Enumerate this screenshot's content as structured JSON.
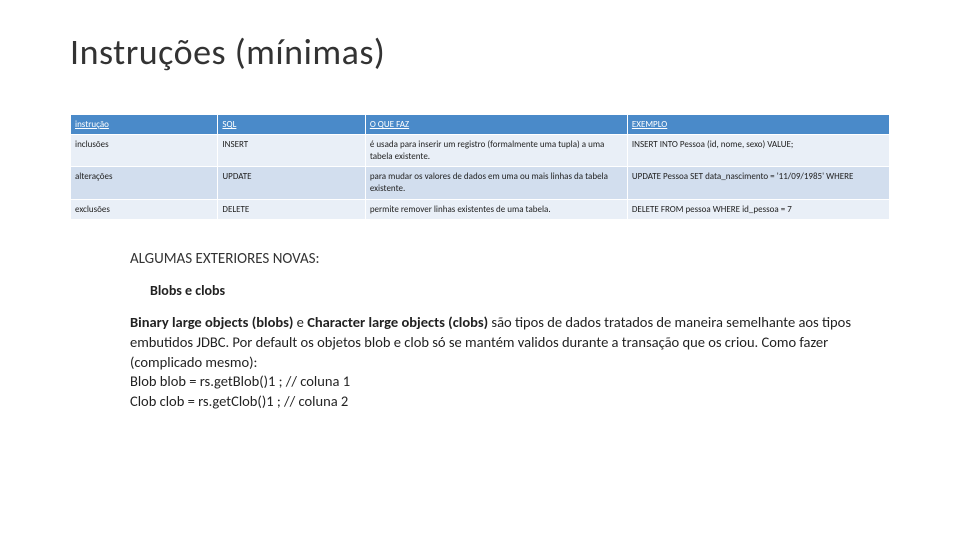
{
  "title": "Instruções (mínimas)",
  "table": {
    "headers": {
      "c1": "instrução",
      "c2": "SQL",
      "c3": "O QUE FAZ",
      "c4": "EXEMPLO"
    },
    "rows": [
      {
        "c1": "inclusões",
        "c2": "INSERT",
        "c3": "é usada para inserir um registro (formalmente uma tupla) a uma tabela existente.",
        "c4": "INSERT INTO Pessoa (id, nome, sexo) VALUE;"
      },
      {
        "c1": "alterações",
        "c2": "UPDATE",
        "c3": "para mudar os valores de dados em uma ou mais linhas da tabela existente.",
        "c4": "UPDATE Pessoa SET data_nascimento = '11/09/1985' WHERE"
      },
      {
        "c1": "exclusões",
        "c2": "DELETE",
        "c3": "permite remover linhas existentes de uma tabela.",
        "c4": "DELETE FROM pessoa WHERE id_pessoa = 7"
      }
    ]
  },
  "section1": "ALGUMAS EXTERIORES NOVAS:",
  "section2": "Blobs e clobs",
  "para": {
    "bold1": "Binary large objects (blobs)",
    "mid1": " e ",
    "bold2": "Character large objects (clobs)",
    "rest": " são tipos de dados tratados de maneira semelhante aos tipos embutidos JDBC. Por default os objetos blob e clob só se mantém validos durante a transação que os criou.   Como fazer (complicado mesmo):",
    "line2": "Blob blob = rs.getBlob()1 ;  // coluna 1",
    "line3": "Clob clob = rs.getClob()1 ;  // coluna 2"
  }
}
